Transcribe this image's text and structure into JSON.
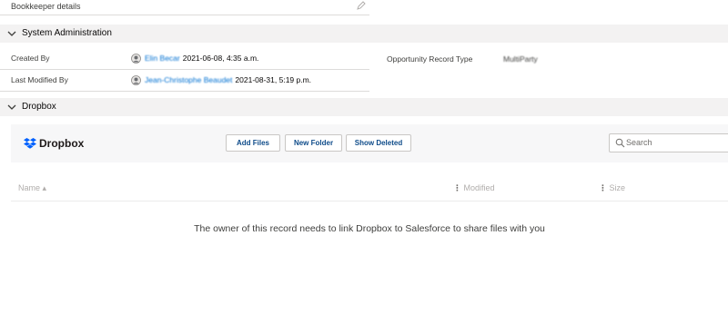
{
  "bookkeeper": {
    "label": "Bookkeeper details",
    "edit_icon": "pencil-icon"
  },
  "system_admin": {
    "title": "System Administration",
    "created_by": {
      "label": "Created By",
      "user": "Elin Becar",
      "datetime": "2021-06-08, 4:35 a.m."
    },
    "last_modified_by": {
      "label": "Last Modified By",
      "user": "Jean-Christophe Beaudet",
      "datetime": "2021-08-31, 5:19 p.m."
    },
    "opportunity_record_type": {
      "label": "Opportunity Record Type",
      "value": "MultiParty"
    }
  },
  "dropbox_section": {
    "title": "Dropbox"
  },
  "dropbox": {
    "logo_text": "Dropbox",
    "buttons": {
      "add_files": "Add Files",
      "new_folder": "New Folder",
      "show_deleted": "Show Deleted"
    },
    "search": {
      "placeholder": "Search",
      "value": ""
    },
    "columns": {
      "name": "Name ▴",
      "modified": "Modified",
      "size": "Size"
    },
    "empty_message": "The owner of this record needs to link Dropbox to Salesforce to share files with you",
    "brand_color": "#0061fe"
  }
}
